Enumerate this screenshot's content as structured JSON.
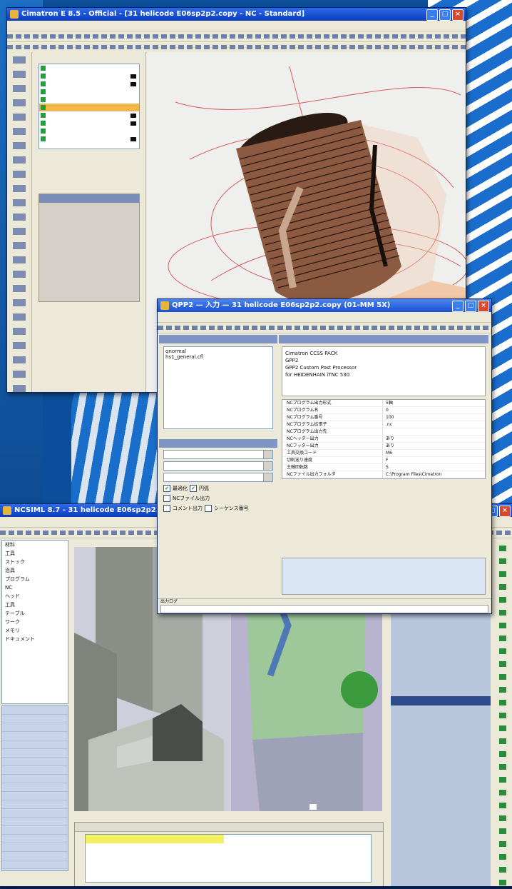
{
  "windows": {
    "cad": {
      "title": "Cimatron E 8.5 - Official - [31 helicode E06sp2p2.copy - NC - Standard]",
      "layers": [
        {
          "name": "",
          "selected": false
        },
        {
          "name": "",
          "selected": false
        },
        {
          "name": "",
          "selected": false
        },
        {
          "name": "",
          "selected": false
        },
        {
          "name": "",
          "selected": false
        },
        {
          "name": "",
          "selected": true
        },
        {
          "name": "",
          "selected": false
        },
        {
          "name": "",
          "selected": false
        },
        {
          "name": "",
          "selected": false
        },
        {
          "name": "",
          "selected": false
        }
      ]
    },
    "qpp": {
      "title": "QPP2 — 入力 — 31 helicode E06sp2p2.copy (01-MM 5X)",
      "file_items": [
        "qnormal",
        "hs1_general.cfl"
      ],
      "doc_lines": [
        "Cimatron CCSS PACK",
        "GPP2",
        "GPP2 Custom Post Processor",
        "for HEIDENHAIN iTNC 530"
      ],
      "params": [
        {
          "k": "NCプログラム出力形式",
          "v": "5軸"
        },
        {
          "k": "NCプログラム名",
          "v": "0"
        },
        {
          "k": "NCプログラム番号",
          "v": "100"
        },
        {
          "k": "NCプログラム拡張子",
          "v": ".nc"
        },
        {
          "k": "NCプログラム出力先",
          "v": ""
        },
        {
          "k": "NCヘッダー出力",
          "v": "あり"
        },
        {
          "k": "NCフッター出力",
          "v": "あり"
        },
        {
          "k": "工具交換コード",
          "v": "M6"
        },
        {
          "k": "切削送り速度",
          "v": "F"
        },
        {
          "k": "主軸回転数",
          "v": "S"
        },
        {
          "k": "NCファイル出力フォルダ",
          "v": "C:\\Program Files\\Cimatron"
        }
      ],
      "checks": [
        "最適化",
        "円弧",
        "NCファイル出力",
        "コメント出力",
        "シーケンス番号"
      ],
      "status_label": "出力ログ",
      "status_msg": ""
    },
    "sim": {
      "title": "NCSIML 8.7 - 31 helicode E06sp2p2.copy",
      "tree_items": [
        "材料",
        "工具",
        "ストック",
        "治具",
        "プログラム",
        "NC",
        "ヘッド",
        "工具",
        "テーブル",
        "ワーク",
        "メモリ",
        "ドキュメント"
      ],
      "list_items": [
        "",
        "",
        "",
        "",
        "",
        "",
        "",
        "",
        "",
        "",
        "",
        "",
        "",
        "",
        "",
        "",
        "",
        "",
        ""
      ],
      "code_lines": [
        "",
        "",
        "",
        "",
        "",
        "",
        "",
        "",
        "",
        "",
        "",
        "",
        "",
        "",
        "",
        "",
        "",
        "",
        "",
        "",
        "",
        "",
        "",
        "",
        "",
        "",
        "",
        "",
        "",
        "",
        "",
        "",
        "",
        "",
        ""
      ],
      "code_hl_index": 17,
      "msg_tabs": "",
      "messages": [
        "",
        "",
        ""
      ]
    }
  }
}
